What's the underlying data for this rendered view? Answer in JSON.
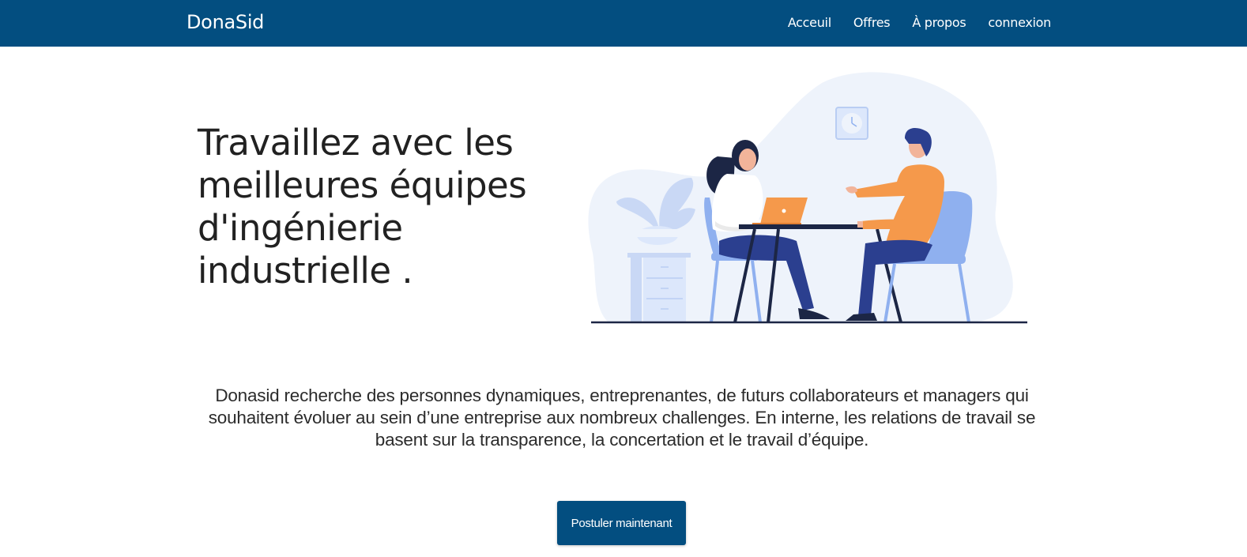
{
  "navbar": {
    "brand": "DonaSid",
    "links": [
      {
        "label": "Acceuil"
      },
      {
        "label": "Offres"
      },
      {
        "label": "À propos"
      },
      {
        "label": "connexion"
      }
    ]
  },
  "hero": {
    "title_lines": [
      "Travaillez avec les",
      "meilleures équipes",
      "d'ingénierie",
      "industrielle ."
    ],
    "illustration_icon": "interview-illustration"
  },
  "description": "Donasid recherche des personnes dynamiques, entreprenantes, de futurs collaborateurs et managers qui souhaitent évoluer au sein d’une entreprise aux nombreux challenges. En interne, les relations de travail se basent sur la transparence, la concertation et le travail d’équipe.",
  "cta": {
    "label": "Postuler maintenant"
  },
  "colors": {
    "primary": "#034e80",
    "illustration_blob": "#eef3fb",
    "chair": "#8fb0ef",
    "person_orange": "#f5994b",
    "pants": "#2b3f8f",
    "table": "#1c2645"
  }
}
